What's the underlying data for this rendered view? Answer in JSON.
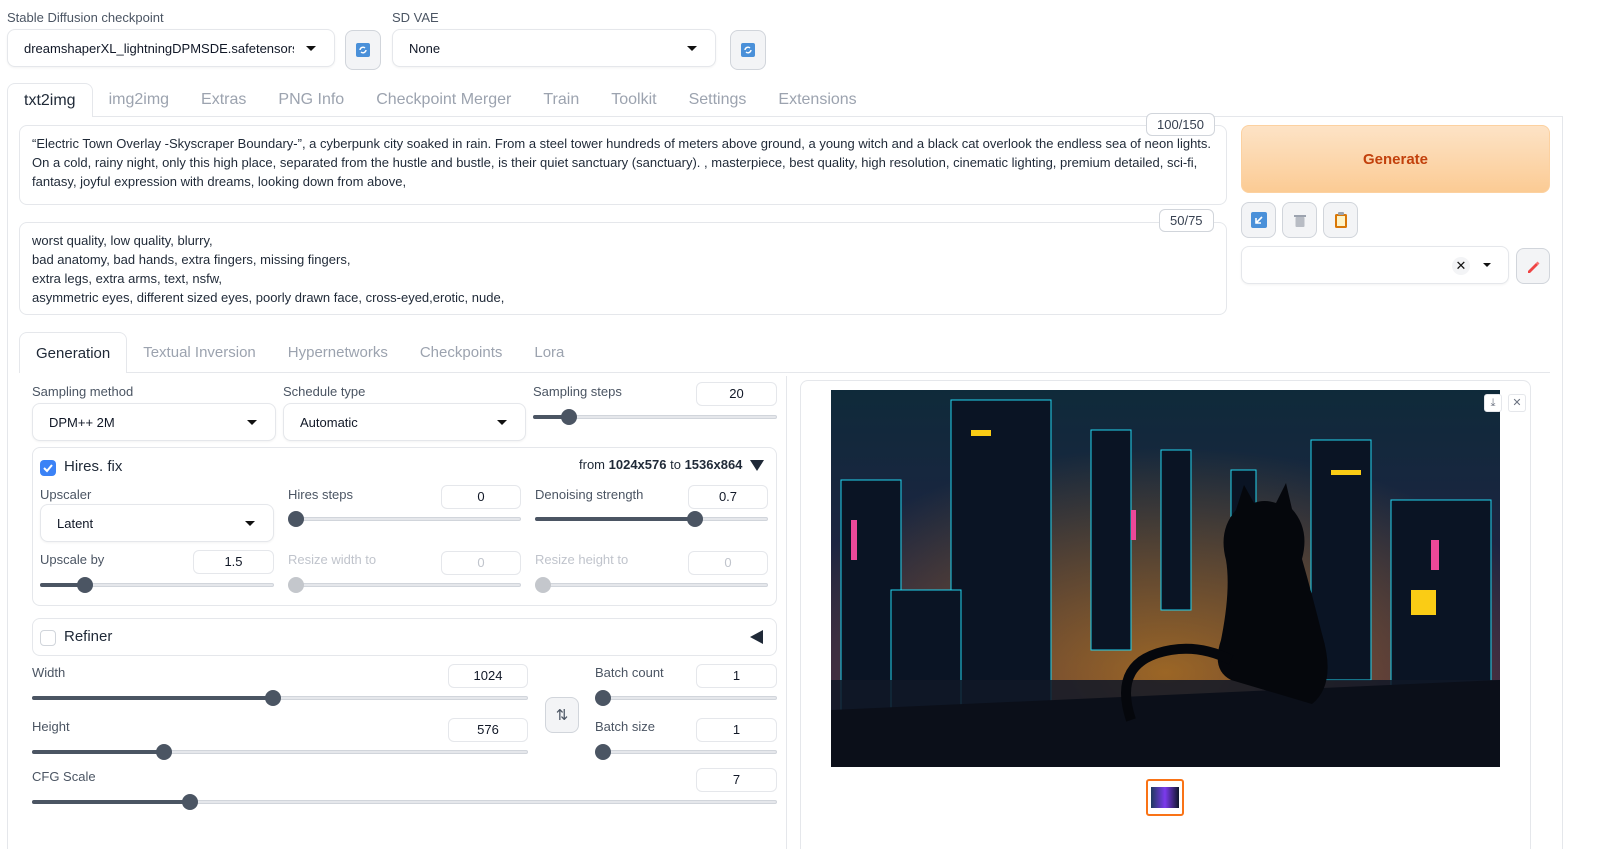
{
  "header": {
    "checkpoint_label": "Stable Diffusion checkpoint",
    "checkpoint_value": "dreamshaperXL_lightningDPMSDE.safetensors",
    "vae_label": "SD VAE",
    "vae_value": "None"
  },
  "main_tabs": [
    "txt2img",
    "img2img",
    "Extras",
    "PNG Info",
    "Checkpoint Merger",
    "Train",
    "Toolkit",
    "Settings",
    "Extensions"
  ],
  "prompt": {
    "text": "“Electric Town Overlay -Skyscraper Boundary-”, a cyberpunk city soaked in rain. From a steel tower hundreds of meters above ground, a young witch and a black cat overlook the endless sea of neon lights.\nOn a cold, rainy night, only this high place, separated from the hustle and bustle, is their quiet sanctuary (sanctuary). , masterpiece, best quality, high resolution, cinematic lighting, premium detailed, sci-fi,\nfantasy, joyful expression with dreams, looking down from above,",
    "counter": "100/150"
  },
  "negative_prompt": {
    "text": "worst quality, low quality, blurry,\nbad anatomy, bad hands, extra fingers, missing fingers,\nextra legs, extra arms, text, nsfw,\nasymmetric eyes, different sized eyes, poorly drawn face, cross-eyed,erotic, nude,",
    "counter": "50/75"
  },
  "generate_label": "Generate",
  "sub_tabs": [
    "Generation",
    "Textual Inversion",
    "Hypernetworks",
    "Checkpoints",
    "Lora"
  ],
  "sampling": {
    "method_label": "Sampling method",
    "method_value": "DPM++ 2M",
    "schedule_label": "Schedule type",
    "schedule_value": "Automatic",
    "steps_label": "Sampling steps",
    "steps_value": "20"
  },
  "hires": {
    "label": "Hires. fix",
    "from_prefix": "from",
    "from_size": "1024x576",
    "to_prefix": "to",
    "to_size": "1536x864",
    "upscaler_label": "Upscaler",
    "upscaler_value": "Latent",
    "steps_label": "Hires steps",
    "steps_value": "0",
    "denoise_label": "Denoising strength",
    "denoise_value": "0.7",
    "upscale_by_label": "Upscale by",
    "upscale_by_value": "1.5",
    "resize_w_label": "Resize width to",
    "resize_w_value": "0",
    "resize_h_label": "Resize height to",
    "resize_h_value": "0"
  },
  "refiner": {
    "label": "Refiner"
  },
  "size": {
    "width_label": "Width",
    "width_value": "1024",
    "height_label": "Height",
    "height_value": "576",
    "batch_count_label": "Batch count",
    "batch_count_value": "1",
    "batch_size_label": "Batch size",
    "batch_size_value": "1",
    "cfg_label": "CFG Scale",
    "cfg_value": "7"
  },
  "colors": {
    "generate_bg": "#fbd3a8",
    "generate_text": "#c2410c",
    "accent": "#3b82f6",
    "thumb_border": "#f97316"
  }
}
